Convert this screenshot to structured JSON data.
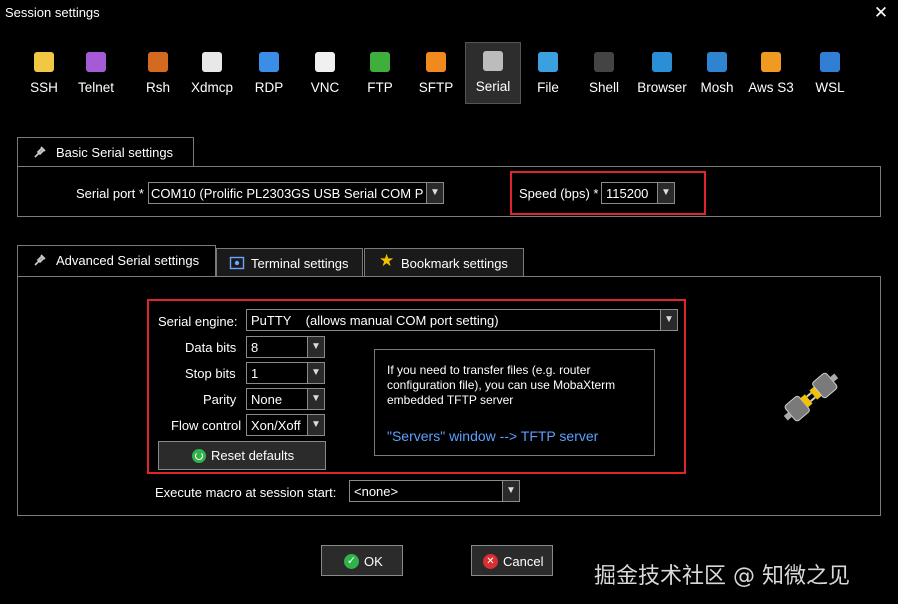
{
  "window": {
    "title": "Session settings",
    "close_glyph": "✕"
  },
  "toolbar": {
    "items": [
      {
        "label": "SSH",
        "icon": "ssh-icon",
        "color": "#f2c744"
      },
      {
        "label": "Telnet",
        "icon": "telnet-icon",
        "color": "#a55bd6"
      },
      {
        "label": "Rsh",
        "icon": "rsh-icon",
        "color": "#d46a1f"
      },
      {
        "label": "Xdmcp",
        "icon": "xdmcp-icon",
        "color": "#e8e8e8"
      },
      {
        "label": "RDP",
        "icon": "rdp-icon",
        "color": "#3a8ee6"
      },
      {
        "label": "VNC",
        "icon": "vnc-icon",
        "color": "#f0f0f0"
      },
      {
        "label": "FTP",
        "icon": "ftp-icon",
        "color": "#3fae3a"
      },
      {
        "label": "SFTP",
        "icon": "sftp-icon",
        "color": "#f08a1c"
      },
      {
        "label": "Serial",
        "icon": "serial-icon",
        "color": "#bcbcbc"
      },
      {
        "label": "File",
        "icon": "file-icon",
        "color": "#3aa0e0"
      },
      {
        "label": "Shell",
        "icon": "shell-icon",
        "color": "#444444"
      },
      {
        "label": "Browser",
        "icon": "browser-icon",
        "color": "#2b8fd8"
      },
      {
        "label": "Mosh",
        "icon": "mosh-icon",
        "color": "#2f84d1"
      },
      {
        "label": "Aws S3",
        "icon": "aws-s3-icon",
        "color": "#f09a22"
      },
      {
        "label": "WSL",
        "icon": "wsl-icon",
        "color": "#2f7fd6"
      }
    ],
    "active": "Serial"
  },
  "basic": {
    "tab_label": "Basic Serial settings",
    "serial_port_label": "Serial port *",
    "serial_port_value": "COM10  (Prolific PL2303GS USB Serial COM P",
    "speed_label": "Speed (bps) *",
    "speed_value": "115200"
  },
  "tabs": {
    "advanced": "Advanced Serial settings",
    "terminal": "Terminal settings",
    "bookmark": "Bookmark settings"
  },
  "advanced": {
    "engine_label": "Serial engine:",
    "engine_value": "PuTTY    (allows manual COM port setting)",
    "data_bits_label": "Data bits",
    "data_bits_value": "8",
    "stop_bits_label": "Stop bits",
    "stop_bits_value": "1",
    "parity_label": "Parity",
    "parity_value": "None",
    "flow_label": "Flow control",
    "flow_value": "Xon/Xoff",
    "reset_label": "Reset defaults",
    "info_text": "If you need to transfer files (e.g. router configuration file), you can use MobaXterm embedded TFTP server",
    "info_link": "\"Servers\" window  -->  TFTP server",
    "macro_label": "Execute macro at session start:",
    "macro_value": "<none>"
  },
  "footer": {
    "ok_label": "OK",
    "cancel_label": "Cancel",
    "watermark": "掘金技术社区 @ 知微之见"
  },
  "colors": {
    "highlight": "#e0242a",
    "link": "#5aa0ff",
    "ok": "#2fb34a",
    "cancel": "#d83030"
  }
}
